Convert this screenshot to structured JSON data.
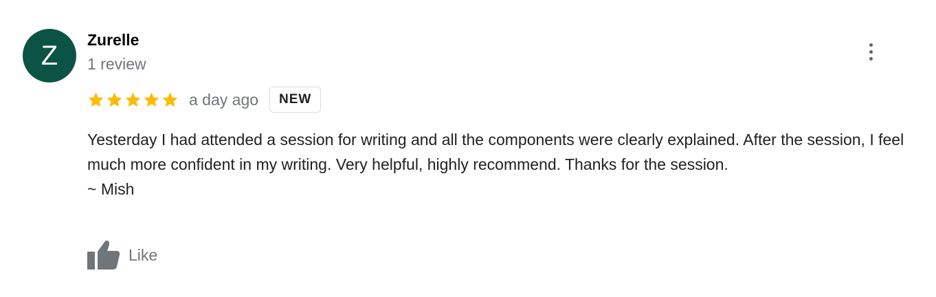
{
  "review": {
    "avatar_letter": "Z",
    "avatar_color": "#0b5345",
    "reviewer_name": "Zurelle",
    "review_count": "1 review",
    "rating": 5,
    "rating_max": 5,
    "star_color": "#fbbc04",
    "date": "a day ago",
    "badge": "NEW",
    "text": "Yesterday I had attended a session for writing and all the components were clearly explained. After the session, I feel much more confident in my writing. Very helpful, highly recommend. Thanks for the session.\n~ Mish",
    "more_icon": "more-vert-icon",
    "like_icon": "thumb-up-icon",
    "like_label": "Like"
  }
}
